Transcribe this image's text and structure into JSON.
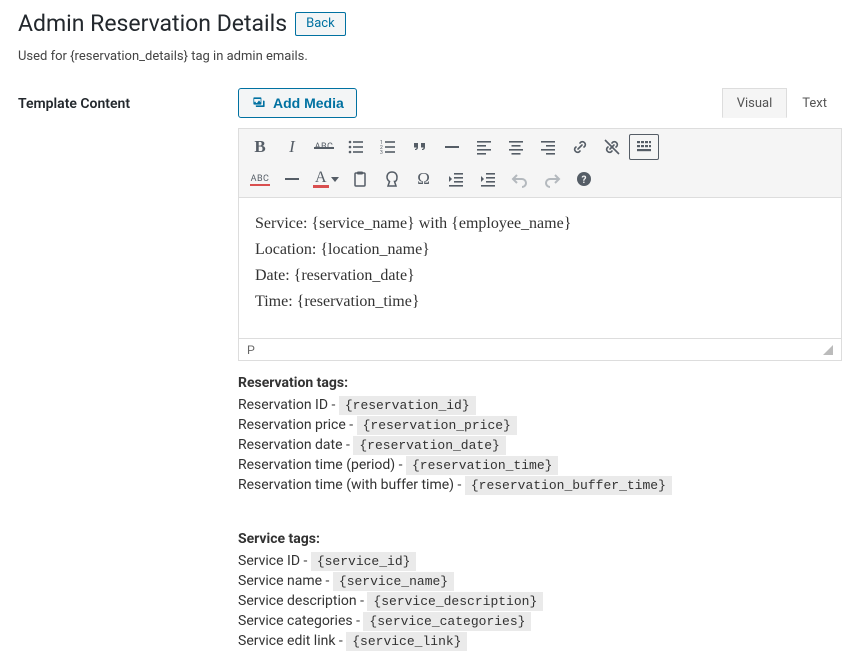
{
  "header": {
    "title": "Admin Reservation Details",
    "back_label": "Back",
    "subtitle": "Used for {reservation_details} tag in admin emails."
  },
  "form": {
    "label_template_content": "Template Content",
    "add_media_label": "Add Media",
    "tabs": {
      "visual": "Visual",
      "text": "Text"
    },
    "content_lines": [
      "Service: {service_name} with {employee_name}",
      "Location: {location_name}",
      "Date: {reservation_date}",
      "Time: {reservation_time}"
    ],
    "status_path": "P"
  },
  "toolbar": {
    "bold": "B",
    "italic": "I",
    "color_letter": "A"
  },
  "tags": {
    "reservation": {
      "heading": "Reservation tags:",
      "items": [
        {
          "label": "Reservation ID - ",
          "code": "{reservation_id}"
        },
        {
          "label": "Reservation price - ",
          "code": "{reservation_price}"
        },
        {
          "label": "Reservation date - ",
          "code": "{reservation_date}"
        },
        {
          "label": "Reservation time (period) - ",
          "code": "{reservation_time}"
        },
        {
          "label": "Reservation time (with buffer time) - ",
          "code": "{reservation_buffer_time}"
        }
      ]
    },
    "service": {
      "heading": "Service tags:",
      "items": [
        {
          "label": "Service ID - ",
          "code": "{service_id}"
        },
        {
          "label": "Service name - ",
          "code": "{service_name}"
        },
        {
          "label": "Service description - ",
          "code": "{service_description}"
        },
        {
          "label": "Service categories - ",
          "code": "{service_categories}"
        },
        {
          "label": "Service edit link - ",
          "code": "{service_link}"
        }
      ]
    }
  }
}
